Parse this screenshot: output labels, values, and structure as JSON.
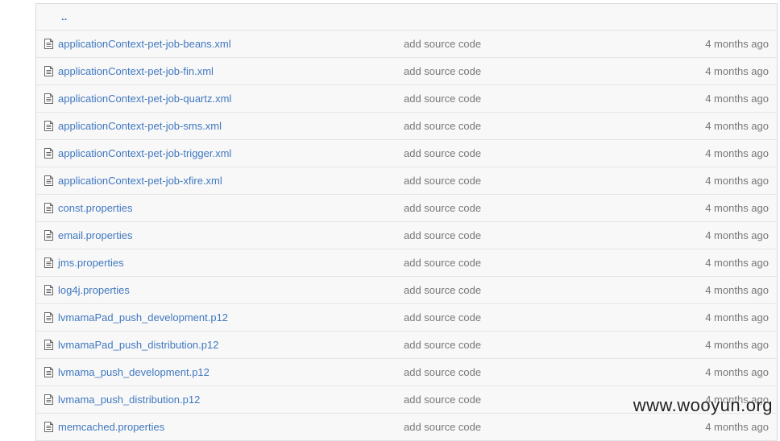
{
  "up_link_label": "..",
  "files": [
    {
      "name": "applicationContext-pet-job-beans.xml",
      "message": "add source code",
      "age": "4 months ago"
    },
    {
      "name": "applicationContext-pet-job-fin.xml",
      "message": "add source code",
      "age": "4 months ago"
    },
    {
      "name": "applicationContext-pet-job-quartz.xml",
      "message": "add source code",
      "age": "4 months ago"
    },
    {
      "name": "applicationContext-pet-job-sms.xml",
      "message": "add source code",
      "age": "4 months ago"
    },
    {
      "name": "applicationContext-pet-job-trigger.xml",
      "message": "add source code",
      "age": "4 months ago"
    },
    {
      "name": "applicationContext-pet-job-xfire.xml",
      "message": "add source code",
      "age": "4 months ago"
    },
    {
      "name": "const.properties",
      "message": "add source code",
      "age": "4 months ago"
    },
    {
      "name": "email.properties",
      "message": "add source code",
      "age": "4 months ago"
    },
    {
      "name": "jms.properties",
      "message": "add source code",
      "age": "4 months ago"
    },
    {
      "name": "log4j.properties",
      "message": "add source code",
      "age": "4 months ago"
    },
    {
      "name": "lvmamaPad_push_development.p12",
      "message": "add source code",
      "age": "4 months ago"
    },
    {
      "name": "lvmamaPad_push_distribution.p12",
      "message": "add source code",
      "age": "4 months ago"
    },
    {
      "name": "lvmama_push_development.p12",
      "message": "add source code",
      "age": "4 months ago"
    },
    {
      "name": "lvmama_push_distribution.p12",
      "message": "add source code",
      "age": "4 months ago"
    },
    {
      "name": "memcached.properties",
      "message": "add source code",
      "age": "4 months ago"
    }
  ],
  "watermark": "www.wooyun.org",
  "colors": {
    "link": "#4078c0",
    "muted": "#777777",
    "row_bg": "#f8f8f8",
    "border": "#e5e5e5"
  },
  "icons": {
    "file": "file-text-icon"
  }
}
